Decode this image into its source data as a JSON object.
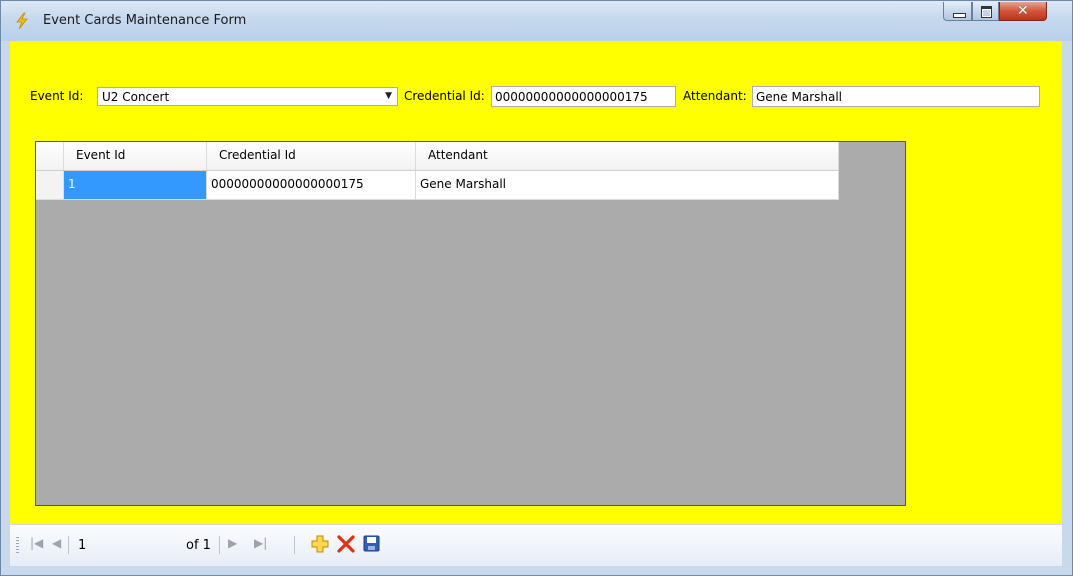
{
  "window": {
    "title": "Event Cards Maintenance Form"
  },
  "form": {
    "event_id_label": "Event Id:",
    "event_id_value": "U2 Concert",
    "credential_id_label": "Credential Id:",
    "credential_id_value": "00000000000000000175",
    "attendant_label": "Attendant:",
    "attendant_value": "Gene Marshall"
  },
  "grid": {
    "columns": [
      "Event Id",
      "Credential Id",
      "Attendant"
    ],
    "rows": [
      [
        "1",
        "00000000000000000175",
        "Gene Marshall"
      ]
    ]
  },
  "navigator": {
    "position": "1",
    "count_text": "of 1"
  },
  "colors": {
    "form_background": "#ffff00",
    "grid_background": "#ababab",
    "selection": "#3399ff"
  }
}
